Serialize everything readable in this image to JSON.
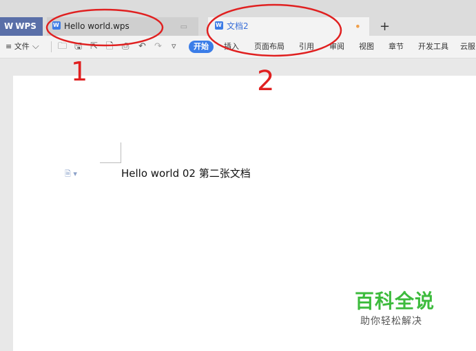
{
  "tabs": {
    "app_label": "WPS",
    "tab1_label": "Hello world.wps",
    "tab2_label": "文档2",
    "new_tab": "+"
  },
  "toolbar": {
    "menu_label": "≡ 文件",
    "start": "开始",
    "insert": "插入",
    "layout": "页面布局",
    "references": "引用",
    "review": "审阅",
    "view": "视图",
    "chapter": "章节",
    "dev_tools": "开发工具",
    "cloud": "云服"
  },
  "document": {
    "text": "Hello world 02 第二张文档"
  },
  "annotations": {
    "label_1": "1",
    "label_2": "2",
    "color": "#e02020"
  },
  "watermark": {
    "title": "百科全说",
    "subtitle": "助你轻松解决"
  }
}
